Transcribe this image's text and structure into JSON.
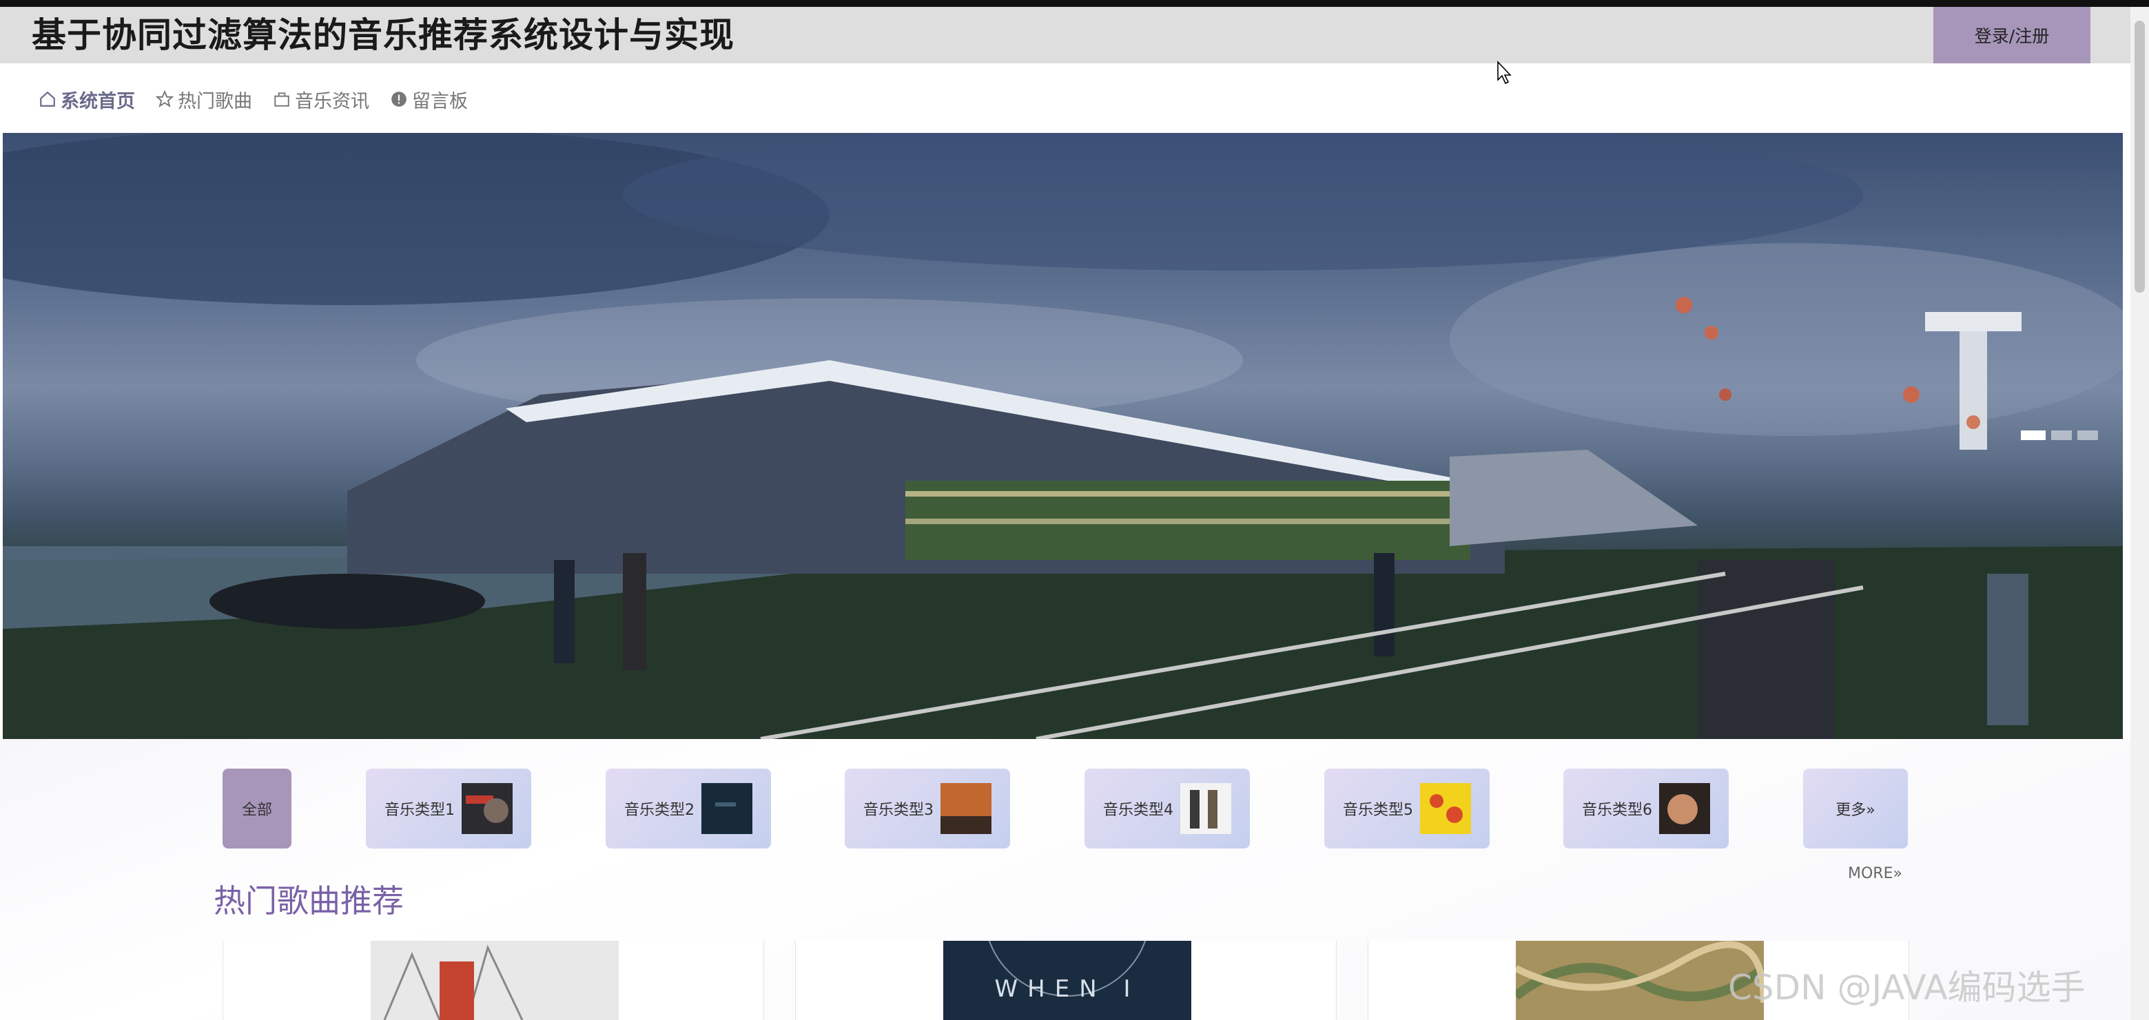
{
  "header": {
    "site_title": "基于协同过滤算法的音乐推荐系统设计与实现",
    "login_label": "登录/注册"
  },
  "nav": [
    {
      "label": "系统首页",
      "icon": "home-icon",
      "active": true
    },
    {
      "label": "热门歌曲",
      "icon": "star-icon",
      "active": false
    },
    {
      "label": "音乐资讯",
      "icon": "bag-icon",
      "active": false
    },
    {
      "label": "留言板",
      "icon": "alert-circle-icon",
      "active": false
    }
  ],
  "categories": {
    "all": "全部",
    "items": [
      "音乐类型1",
      "音乐类型2",
      "音乐类型3",
      "音乐类型4",
      "音乐类型5",
      "音乐类型6"
    ],
    "more": "更多»"
  },
  "section": {
    "title": "热门歌曲推荐",
    "more": "MORE»"
  },
  "cards": [
    {
      "art_text": ""
    },
    {
      "art_text": "WHEN I"
    },
    {
      "art_text": ""
    }
  ],
  "watermark": "CSDN @JAVA编码选手",
  "colors": {
    "accent": "#a796ba",
    "title_purple": "#7a61a6",
    "header_bg": "#dedede"
  }
}
